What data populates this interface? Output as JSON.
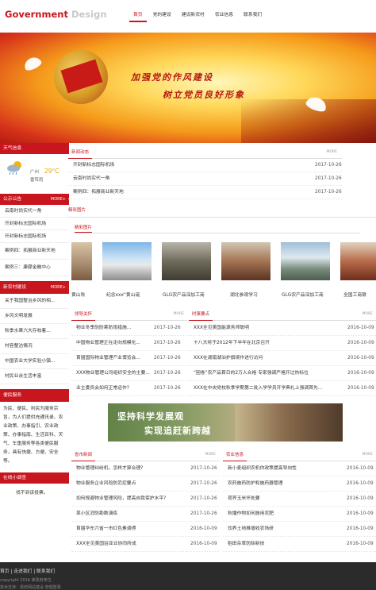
{
  "header": {
    "logo_part1": "Government",
    "logo_part2": "Design",
    "nav": [
      "首页",
      "党的建设",
      "建设新农村",
      "农业信息",
      "联系我们"
    ]
  },
  "banner": {
    "slogan1": "加强党的作风建设",
    "slogan2": "树立党员良好形象"
  },
  "sidebar": {
    "weather_title": "天气信息",
    "weather_city": "广州",
    "weather_temp": "29°C",
    "weather_desc": "雷阵雨",
    "announce_title": "公示公告",
    "announce_more": "MORE+",
    "announce_items": [
      "云南时尚实代一角",
      "开封新标志国际机场",
      "开封新标志国际机场",
      "案例四：拓展商业新天地",
      "案例三：康骤金融中心"
    ],
    "village_title": "新农村建设",
    "village_more": "MORE+",
    "village_items": [
      "关于我国整治乡风的相...",
      "乡风文明发展",
      "秋季水果六大存收着...",
      "村容整洁情况",
      "中国农业大学实验小镇...",
      "村民业余生活丰富"
    ],
    "service_title": "便民服务",
    "service_text": "为民、便民、利民为服务宗旨，为人们提供充通讯录、农业政策、办事指引、农业政策、办事指南、生活百科、天气、车重服务等各类便民服务，具有快捷、方便、安全等。",
    "survey_title": "在线小调查",
    "survey_text": "找不到该投票。"
  },
  "news": {
    "title": "新闻动态",
    "more": "MORE",
    "items": [
      {
        "title": "开封新标志国际机场",
        "date": "2017-10-26"
      },
      {
        "title": "云南时尚实代一角",
        "date": "2017-10-26"
      },
      {
        "title": "案例四：拓展商业新天地",
        "date": "2017-10-26"
      }
    ]
  },
  "gallery": {
    "tab": "精彩图片",
    "title": "精彩图片",
    "captions": [
      "黄山秋",
      "纪念xxx“黄山诞",
      "GLG农产品深加工商",
      "湖北参观学习",
      "GLG农产品深加工商",
      "全国工商联"
    ]
  },
  "leaders": {
    "title": "领导关怀",
    "more": "MORE",
    "items": [
      {
        "title": "物业冬季防防寒防雨措施...",
        "date": "2017-10-26"
      },
      {
        "title": "中国物业管理正在走向规模化...",
        "date": "2017-10-26"
      },
      {
        "title": "首届国际物业管理产业博览会...",
        "date": "2017-10-26"
      },
      {
        "title": "XXX物业管理公司组织安全的主要...",
        "date": "2017-10-26"
      },
      {
        "title": "业主委员会如何正常运作?",
        "date": "2017-10-26"
      }
    ]
  },
  "current": {
    "title": "时事要点",
    "more": "MORE",
    "items": [
      {
        "title": "XXX全见美国能源务师聪明",
        "date": "2016-10-09"
      },
      {
        "title": "十八大将于2012年下半年在北京召开",
        "date": "2016-10-09"
      },
      {
        "title": "XXX在湖南湖泊护旗境作进行访问",
        "date": "2016-10-09"
      },
      {
        "title": "“困卷”农产品首日的2万人合格 专家强调严格开过热标位",
        "date": "2016-10-09"
      },
      {
        "title": "XXX在中央党校秋季学期第二批入学学员开学典礼上强调首先...",
        "date": "2016-10-09"
      }
    ]
  },
  "slogan_banner": {
    "line1": "坚持科学发展观",
    "line2": "实现追赶新跨越"
  },
  "province": {
    "title": "省市新闻",
    "more": "MORE",
    "items": [
      {
        "title": "物业管理纠纷机，怎样才算合理?",
        "date": "2017-10-26"
      },
      {
        "title": "物业服务企业风险防范控要点",
        "date": "2017-10-26"
      },
      {
        "title": "如何规避物业管理风险，提高自我保护水平?",
        "date": "2017-10-26"
      },
      {
        "title": "某小区消防勘数演练",
        "date": "2017-10-26"
      },
      {
        "title": "首届华东六省一市红色素调得",
        "date": "2016-10-09"
      },
      {
        "title": "XXX全见美国驻亚业协同所成",
        "date": "2016-10-09"
      }
    ]
  },
  "agri": {
    "title": "农业信息",
    "more": "MORE",
    "items": [
      {
        "title": "新小麦组织农机你政策提高导向性",
        "date": "2016-10-09"
      },
      {
        "title": "农药施药防护和施药器管理",
        "date": "2016-10-09"
      },
      {
        "title": "荷荞玉米坏处要",
        "date": "2016-10-09"
      },
      {
        "title": "秋播作物如何施用农肥",
        "date": "2016-10-09"
      },
      {
        "title": "饮养土地推增收农场研",
        "date": "2016-10-09"
      },
      {
        "title": "稻田杂草防除新技",
        "date": "2016-10-09"
      }
    ]
  },
  "footer": {
    "links": "首页  |  走进我们  |  联系我们",
    "copy": "copyright 2016 某政府单位",
    "copy2": "技术支持：政府网站建设  管理登录"
  }
}
